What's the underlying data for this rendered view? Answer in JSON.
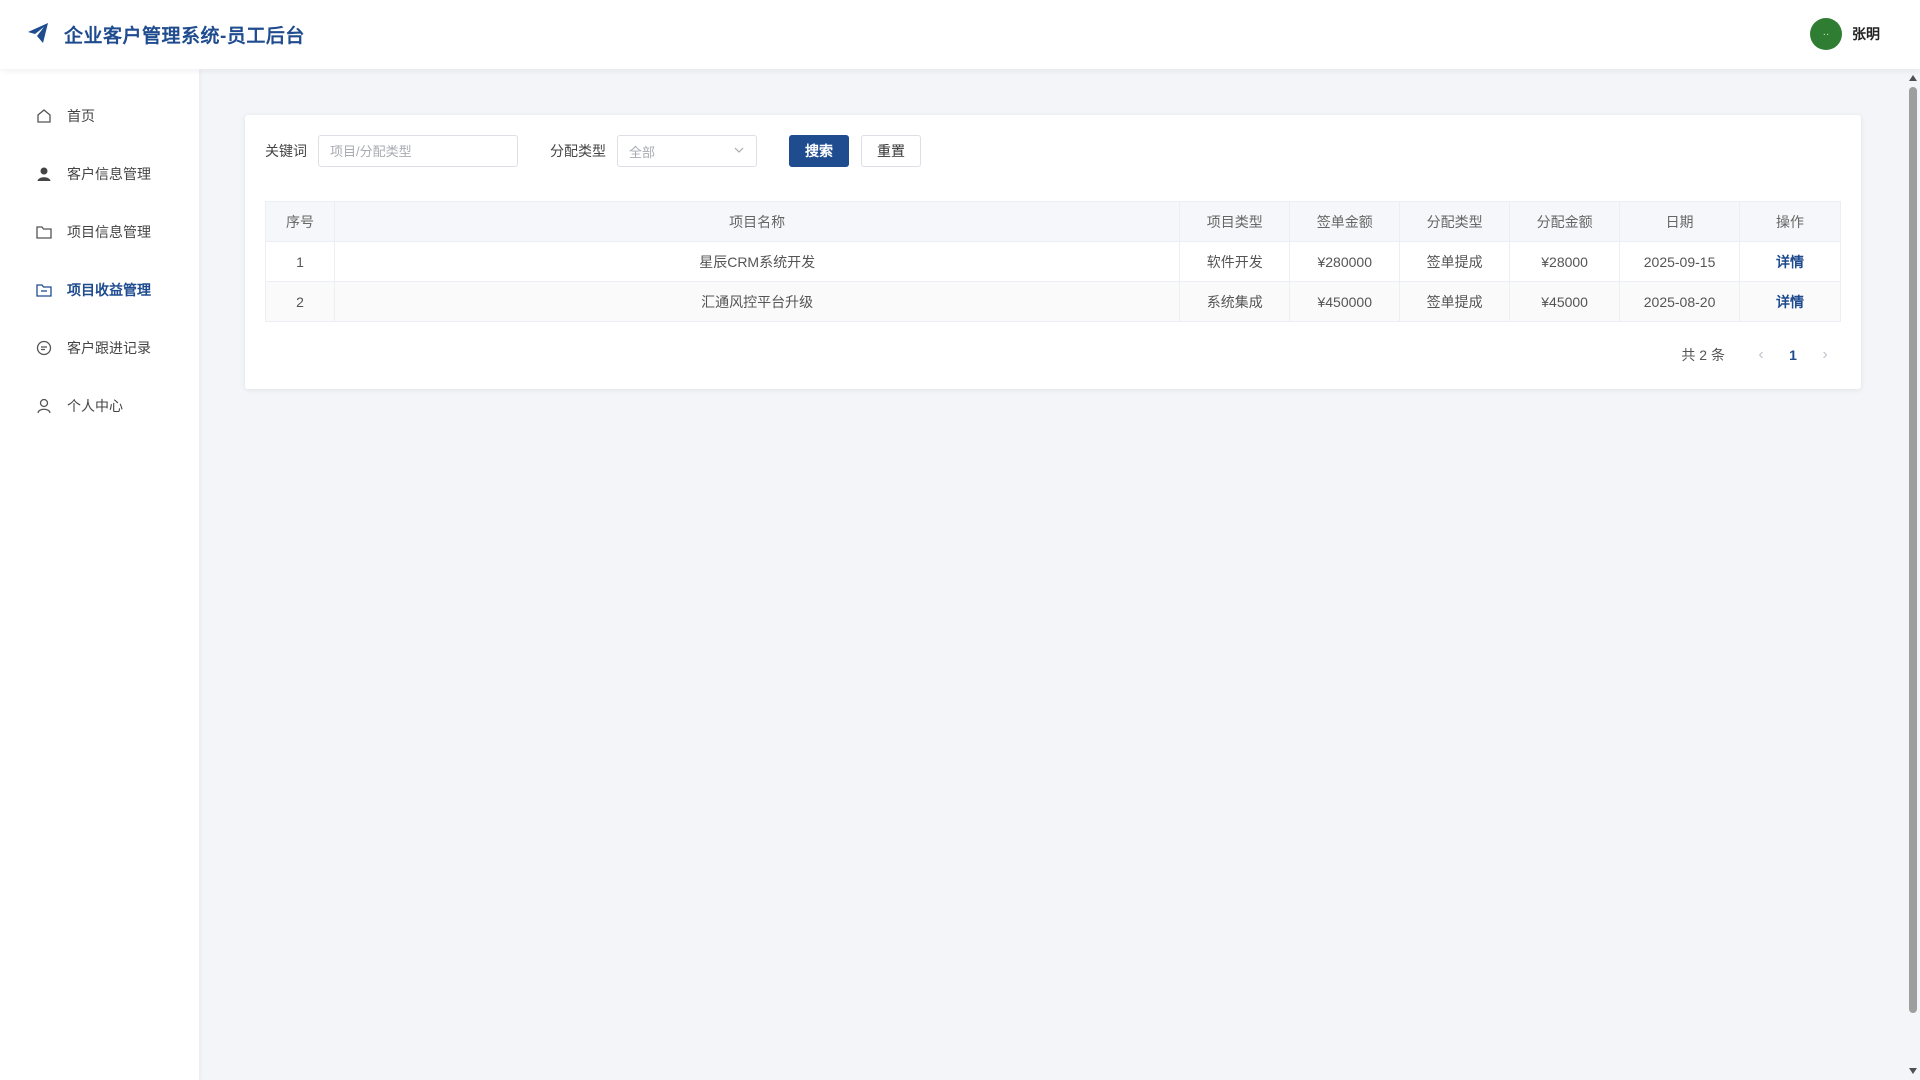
{
  "header": {
    "title": "企业客户管理系统-员工后台",
    "user": {
      "avatar_text": "··",
      "name": "张明"
    }
  },
  "sidebar": {
    "items": [
      {
        "label": "首页",
        "icon": "home-icon"
      },
      {
        "label": "客户信息管理",
        "icon": "user-icon"
      },
      {
        "label": "项目信息管理",
        "icon": "folder-icon"
      },
      {
        "label": "项目收益管理",
        "icon": "folder-revenue-icon",
        "active": true
      },
      {
        "label": "客户跟进记录",
        "icon": "chat-icon"
      },
      {
        "label": "个人中心",
        "icon": "person-icon"
      }
    ]
  },
  "filter": {
    "keyword_label": "关键词",
    "keyword_placeholder": "项目/分配类型",
    "type_label": "分配类型",
    "type_value": "全部",
    "search_label": "搜索",
    "reset_label": "重置"
  },
  "table": {
    "columns": [
      "序号",
      "项目名称",
      "项目类型",
      "签单金额",
      "分配类型",
      "分配金额",
      "日期",
      "操作"
    ],
    "rows": [
      {
        "no": "1",
        "name": "星辰CRM系统开发",
        "type": "软件开发",
        "contract": "¥280000",
        "alloc_type": "签单提成",
        "alloc": "¥28000",
        "date": "2025-09-15",
        "action": "详情"
      },
      {
        "no": "2",
        "name": "汇通风控平台升级",
        "type": "系统集成",
        "contract": "¥450000",
        "alloc_type": "签单提成",
        "alloc": "¥45000",
        "date": "2025-08-20",
        "action": "详情"
      }
    ]
  },
  "pagination": {
    "total_text": "共 2 条",
    "current_page": "1",
    "prev": "‹",
    "next": "›"
  },
  "colors": {
    "accent": "#1f4b8f",
    "avatar": "#2e7d32"
  }
}
